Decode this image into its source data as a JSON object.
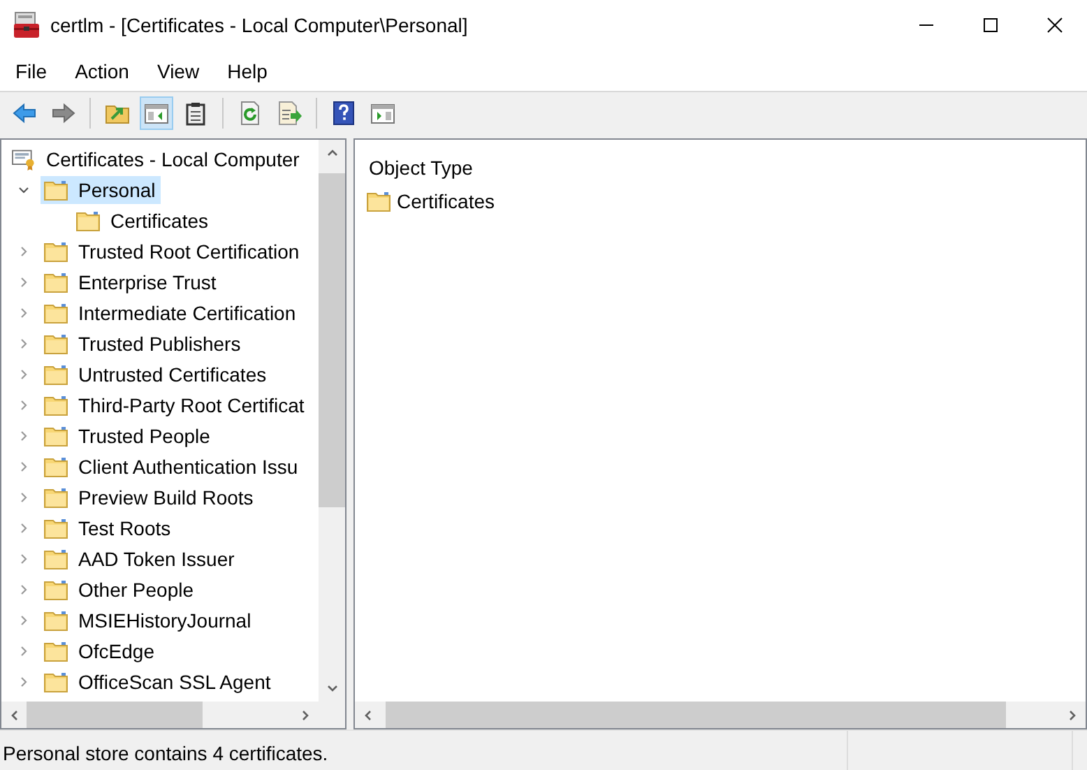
{
  "window": {
    "title": "certlm - [Certificates - Local Computer\\Personal]"
  },
  "menu": [
    "File",
    "Action",
    "View",
    "Help"
  ],
  "toolbar": [
    {
      "kind": "back",
      "pressed": false
    },
    {
      "kind": "forward",
      "pressed": false
    },
    {
      "kind": "sep"
    },
    {
      "kind": "up",
      "pressed": false
    },
    {
      "kind": "tree-toggle",
      "pressed": true
    },
    {
      "kind": "clipboard",
      "pressed": false
    },
    {
      "kind": "sep"
    },
    {
      "kind": "refresh",
      "pressed": false
    },
    {
      "kind": "export",
      "pressed": false
    },
    {
      "kind": "sep"
    },
    {
      "kind": "help",
      "pressed": false
    },
    {
      "kind": "action-pane",
      "pressed": false
    }
  ],
  "tree": {
    "label": "Certificates - Local Computer",
    "selected": false,
    "children": [
      {
        "label": "Personal",
        "expanded": true,
        "selected": true,
        "children": [
          {
            "label": "Certificates",
            "selected": false
          }
        ]
      },
      {
        "label": "Trusted Root Certification",
        "expanded": false,
        "selected": false
      },
      {
        "label": "Enterprise Trust",
        "expanded": false,
        "selected": false
      },
      {
        "label": "Intermediate Certification",
        "expanded": false,
        "selected": false
      },
      {
        "label": "Trusted Publishers",
        "expanded": false,
        "selected": false
      },
      {
        "label": "Untrusted Certificates",
        "expanded": false,
        "selected": false
      },
      {
        "label": "Third-Party Root Certificat",
        "expanded": false,
        "selected": false
      },
      {
        "label": "Trusted People",
        "expanded": false,
        "selected": false
      },
      {
        "label": "Client Authentication Issu",
        "expanded": false,
        "selected": false
      },
      {
        "label": "Preview Build Roots",
        "expanded": false,
        "selected": false
      },
      {
        "label": "Test Roots",
        "expanded": false,
        "selected": false
      },
      {
        "label": "AAD Token Issuer",
        "expanded": false,
        "selected": false
      },
      {
        "label": "Other People",
        "expanded": false,
        "selected": false
      },
      {
        "label": "MSIEHistoryJournal",
        "expanded": false,
        "selected": false
      },
      {
        "label": "OfcEdge",
        "expanded": false,
        "selected": false
      },
      {
        "label": "OfficeScan SSL Agent",
        "expanded": false,
        "selected": false
      }
    ]
  },
  "list": {
    "columns": [
      "Object Type"
    ],
    "rows": [
      "Certificates"
    ]
  },
  "status_bar": "Personal store contains 4 certificates."
}
